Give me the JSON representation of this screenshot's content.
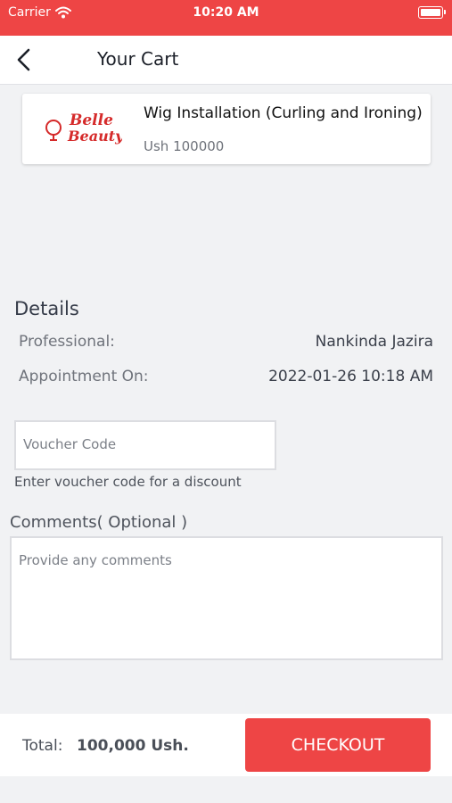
{
  "status_bar": {
    "carrier": "Carrier",
    "time": "10:20 AM"
  },
  "nav": {
    "title": "Your Cart"
  },
  "cart_item": {
    "name": "Wig Installation (Curling and Ironing)",
    "price": "Ush 100000",
    "logo_text": [
      "Belle",
      "Beauty"
    ]
  },
  "details": {
    "title": "Details",
    "rows": [
      {
        "label": "Professional:",
        "value": "Nankinda Jazira"
      },
      {
        "label": "Appointment On:",
        "value": "2022-01-26 10:18 AM"
      }
    ]
  },
  "voucher": {
    "placeholder": "Voucher Code",
    "hint": "Enter voucher code for a discount"
  },
  "comments": {
    "label": "Comments( Optional )",
    "placeholder": "Provide any comments"
  },
  "footer": {
    "total_label": "Total:",
    "total_value": "100,000 Ush.",
    "checkout_label": "CHECKOUT"
  },
  "colors": {
    "accent": "#ee4545",
    "background": "#f1f2f4"
  }
}
